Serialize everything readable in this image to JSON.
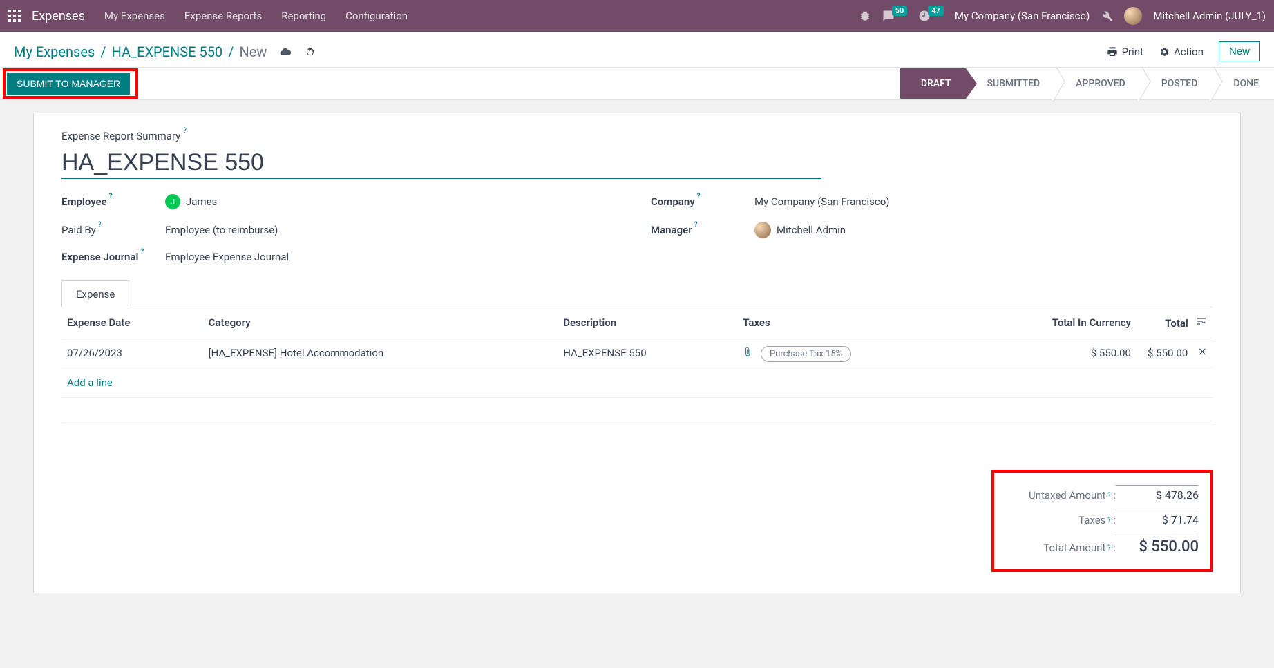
{
  "nav": {
    "brand": "Expenses",
    "items": [
      "My Expenses",
      "Expense Reports",
      "Reporting",
      "Configuration"
    ],
    "company": "My Company (San Francisco)",
    "user": "Mitchell Admin (JULY_1)",
    "msg_badge": "50",
    "clock_badge": "47"
  },
  "breadcrumb": {
    "root": "My Expenses",
    "mid": "HA_EXPENSE 550",
    "leaf": "New"
  },
  "controls": {
    "print": "Print",
    "action": "Action",
    "new": "New",
    "submit": "SUBMIT TO MANAGER"
  },
  "stages": [
    "DRAFT",
    "SUBMITTED",
    "APPROVED",
    "POSTED",
    "DONE"
  ],
  "form": {
    "summary_label": "Expense Report Summary",
    "title": "HA_EXPENSE 550",
    "employee_label": "Employee",
    "employee_initial": "J",
    "employee_name": "James",
    "paidby_label": "Paid By",
    "paidby_value": "Employee (to reimburse)",
    "journal_label": "Expense Journal",
    "journal_value": "Employee Expense Journal",
    "company_label": "Company",
    "company_value": "My Company (San Francisco)",
    "manager_label": "Manager",
    "manager_value": "Mitchell Admin"
  },
  "tab_label": "Expense",
  "columns": {
    "date": "Expense Date",
    "category": "Category",
    "description": "Description",
    "taxes": "Taxes",
    "total_currency": "Total In Currency",
    "total": "Total"
  },
  "line": {
    "date": "07/26/2023",
    "category": "[HA_EXPENSE] Hotel Accommodation",
    "description": "HA_EXPENSE 550",
    "tax": "Purchase Tax 15%",
    "total_currency": "$ 550.00",
    "total": "$ 550.00"
  },
  "add_line": "Add a line",
  "totals": {
    "untaxed_label": "Untaxed Amount",
    "untaxed_value": "$ 478.26",
    "taxes_label": "Taxes",
    "taxes_value": "$ 71.74",
    "grand_label": "Total Amount",
    "grand_value": "$ 550.00"
  }
}
